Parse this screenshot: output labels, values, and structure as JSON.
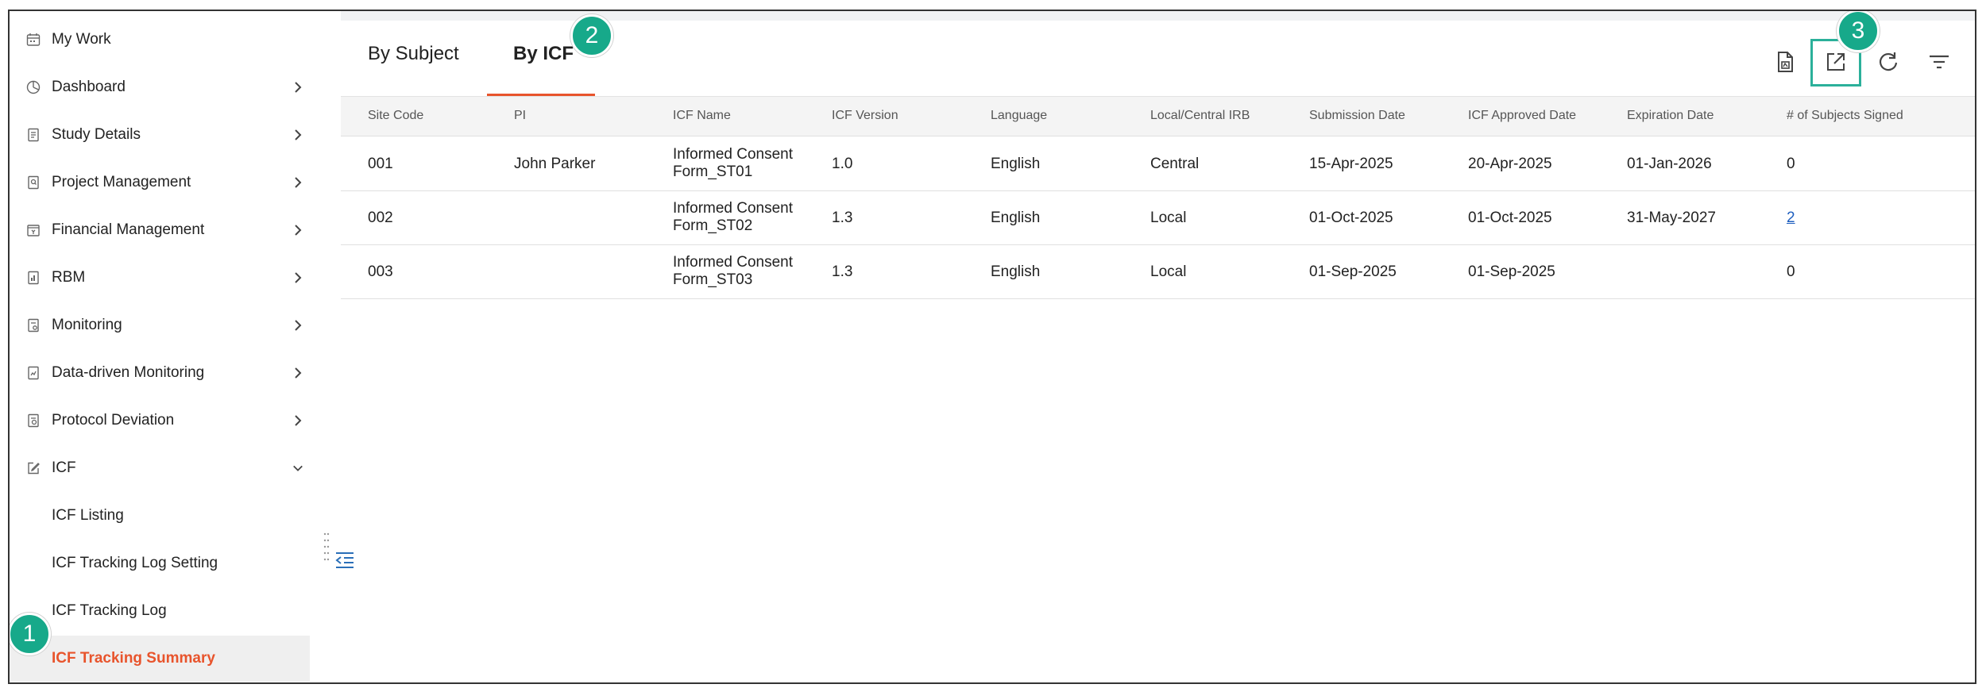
{
  "sidebar": {
    "items": [
      {
        "label": "My Work",
        "icon": "calendar-icon",
        "has_chevron": false
      },
      {
        "label": "Dashboard",
        "icon": "pie-chart-icon",
        "has_chevron": true
      },
      {
        "label": "Study Details",
        "icon": "document-icon",
        "has_chevron": true
      },
      {
        "label": "Project Management",
        "icon": "document-search-icon",
        "has_chevron": true
      },
      {
        "label": "Financial Management",
        "icon": "finance-icon",
        "has_chevron": true
      },
      {
        "label": "RBM",
        "icon": "document-chart-icon",
        "has_chevron": true
      },
      {
        "label": "Monitoring",
        "icon": "document-check-icon",
        "has_chevron": true
      },
      {
        "label": "Data-driven Monitoring",
        "icon": "document-data-icon",
        "has_chevron": true
      },
      {
        "label": "Protocol Deviation",
        "icon": "document-alert-icon",
        "has_chevron": true
      },
      {
        "label": "ICF",
        "icon": "edit-icon",
        "has_chevron": true,
        "expanded": true
      }
    ],
    "sub_items": [
      {
        "label": "ICF Listing"
      },
      {
        "label": "ICF Tracking Log Setting"
      },
      {
        "label": "ICF Tracking Log"
      },
      {
        "label": "ICF Tracking Summary",
        "active": true
      }
    ]
  },
  "tabs": [
    {
      "label": "By Subject",
      "active": false
    },
    {
      "label": "By ICF",
      "active": true
    }
  ],
  "toolbar": {
    "pdf_icon": "pdf-export-icon",
    "export_icon": "external-export-icon",
    "refresh_icon": "refresh-icon",
    "filter_icon": "filter-icon"
  },
  "badges": [
    "1",
    "2",
    "3"
  ],
  "table": {
    "columns": [
      "Site Code",
      "PI",
      "ICF Name",
      "ICF Version",
      "Language",
      "Local/Central IRB",
      "Submission Date",
      "ICF Approved Date",
      "Expiration Date",
      "# of Subjects Signed"
    ],
    "rows": [
      {
        "site": "001",
        "pi": "John Parker",
        "icf_name": "Informed Consent Form_ST01",
        "version": "1.0",
        "language": "English",
        "irb": "Central",
        "submission": "15-Apr-2025",
        "approved": "20-Apr-2025",
        "expiration": "01-Jan-2026",
        "signed": "0",
        "signed_link": false
      },
      {
        "site": "002",
        "pi": "",
        "icf_name": "Informed Consent Form_ST02",
        "version": "1.3",
        "language": "English",
        "irb": "Local",
        "submission": "01-Oct-2025",
        "approved": "01-Oct-2025",
        "expiration": "31-May-2027",
        "signed": "2",
        "signed_link": true
      },
      {
        "site": "003",
        "pi": "",
        "icf_name": "Informed Consent Form_ST03",
        "version": "1.3",
        "language": "English",
        "irb": "Local",
        "submission": "01-Sep-2025",
        "approved": "01-Sep-2025",
        "expiration": "",
        "signed": "0",
        "signed_link": false
      }
    ]
  },
  "colors": {
    "accent": "#e8542c",
    "badge": "#17a98a",
    "link": "#1f5fbf",
    "highlight": "#2bb09a"
  }
}
